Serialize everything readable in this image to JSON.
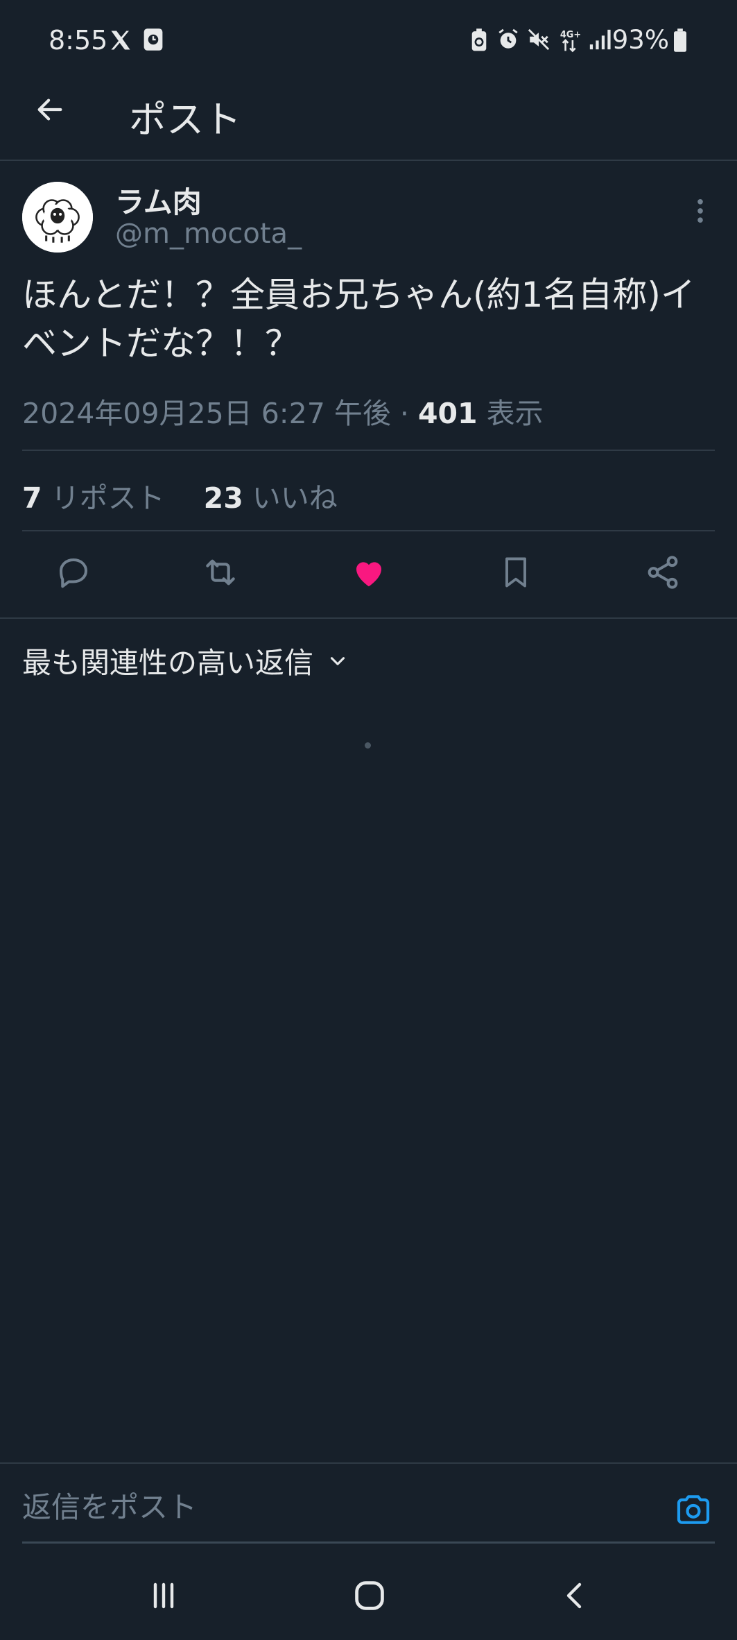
{
  "status_bar": {
    "time": "8:55",
    "battery": "93%",
    "icons": [
      "x-logo-icon",
      "clock-app-icon",
      "battery-saver-icon",
      "alarm-icon",
      "mute-icon",
      "4g-icon",
      "signal-icon",
      "battery-icon"
    ]
  },
  "header": {
    "title": "ポスト"
  },
  "post": {
    "display_name": "ラム肉",
    "handle": "@m_mocota_",
    "text": "ほんとだ！？全員お兄ちゃん(約1名自称)イベントだな？！？",
    "date": "2024年09月25日 6:27 午後",
    "separator": " · ",
    "views_count": "401",
    "views_label": "表示",
    "reposts_count": "7",
    "reposts_label": "リポスト",
    "likes_count": "23",
    "likes_label": "いいね"
  },
  "replies": {
    "sort_label": "最も関連性の高い返信"
  },
  "reply_bar": {
    "placeholder": "返信をポスト"
  },
  "colors": {
    "background": "#17202a",
    "text": "#e7e9ea",
    "muted": "#71808f",
    "like": "#f91880",
    "accent": "#1d9bf0"
  }
}
